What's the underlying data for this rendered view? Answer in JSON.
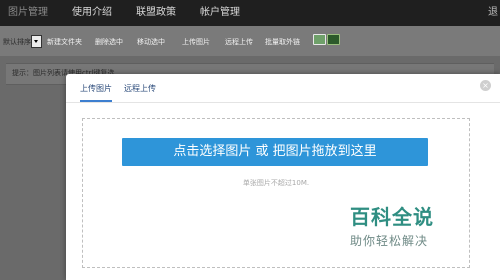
{
  "topnav": {
    "items": [
      "图片管理",
      "使用介绍",
      "联盟政策",
      "帐户管理"
    ],
    "right_label": "退"
  },
  "toolbar": {
    "sort_label": "默认排序",
    "buttons": [
      "新建文件夹",
      "删除选中",
      "移动选中",
      "上传图片",
      "远程上传",
      "批量取外链"
    ],
    "icon_names": [
      "picture-view-icon",
      "list-view-icon"
    ]
  },
  "hint": {
    "text": "提示：图片列表请使用ctrl键复选"
  },
  "dialog": {
    "tabs": [
      "上传图片",
      "远程上传"
    ],
    "active_tab": "上传图片",
    "close_label": "×",
    "select_button_label": "点击选择图片 或 把图片拖放到这里",
    "limit_text": "单张图片不超过10M."
  },
  "watermark": {
    "title": "百科全说",
    "subtitle": "助你轻松解决"
  },
  "colors": {
    "accent": "#2e95d9",
    "watermark": "#2f8e82"
  }
}
